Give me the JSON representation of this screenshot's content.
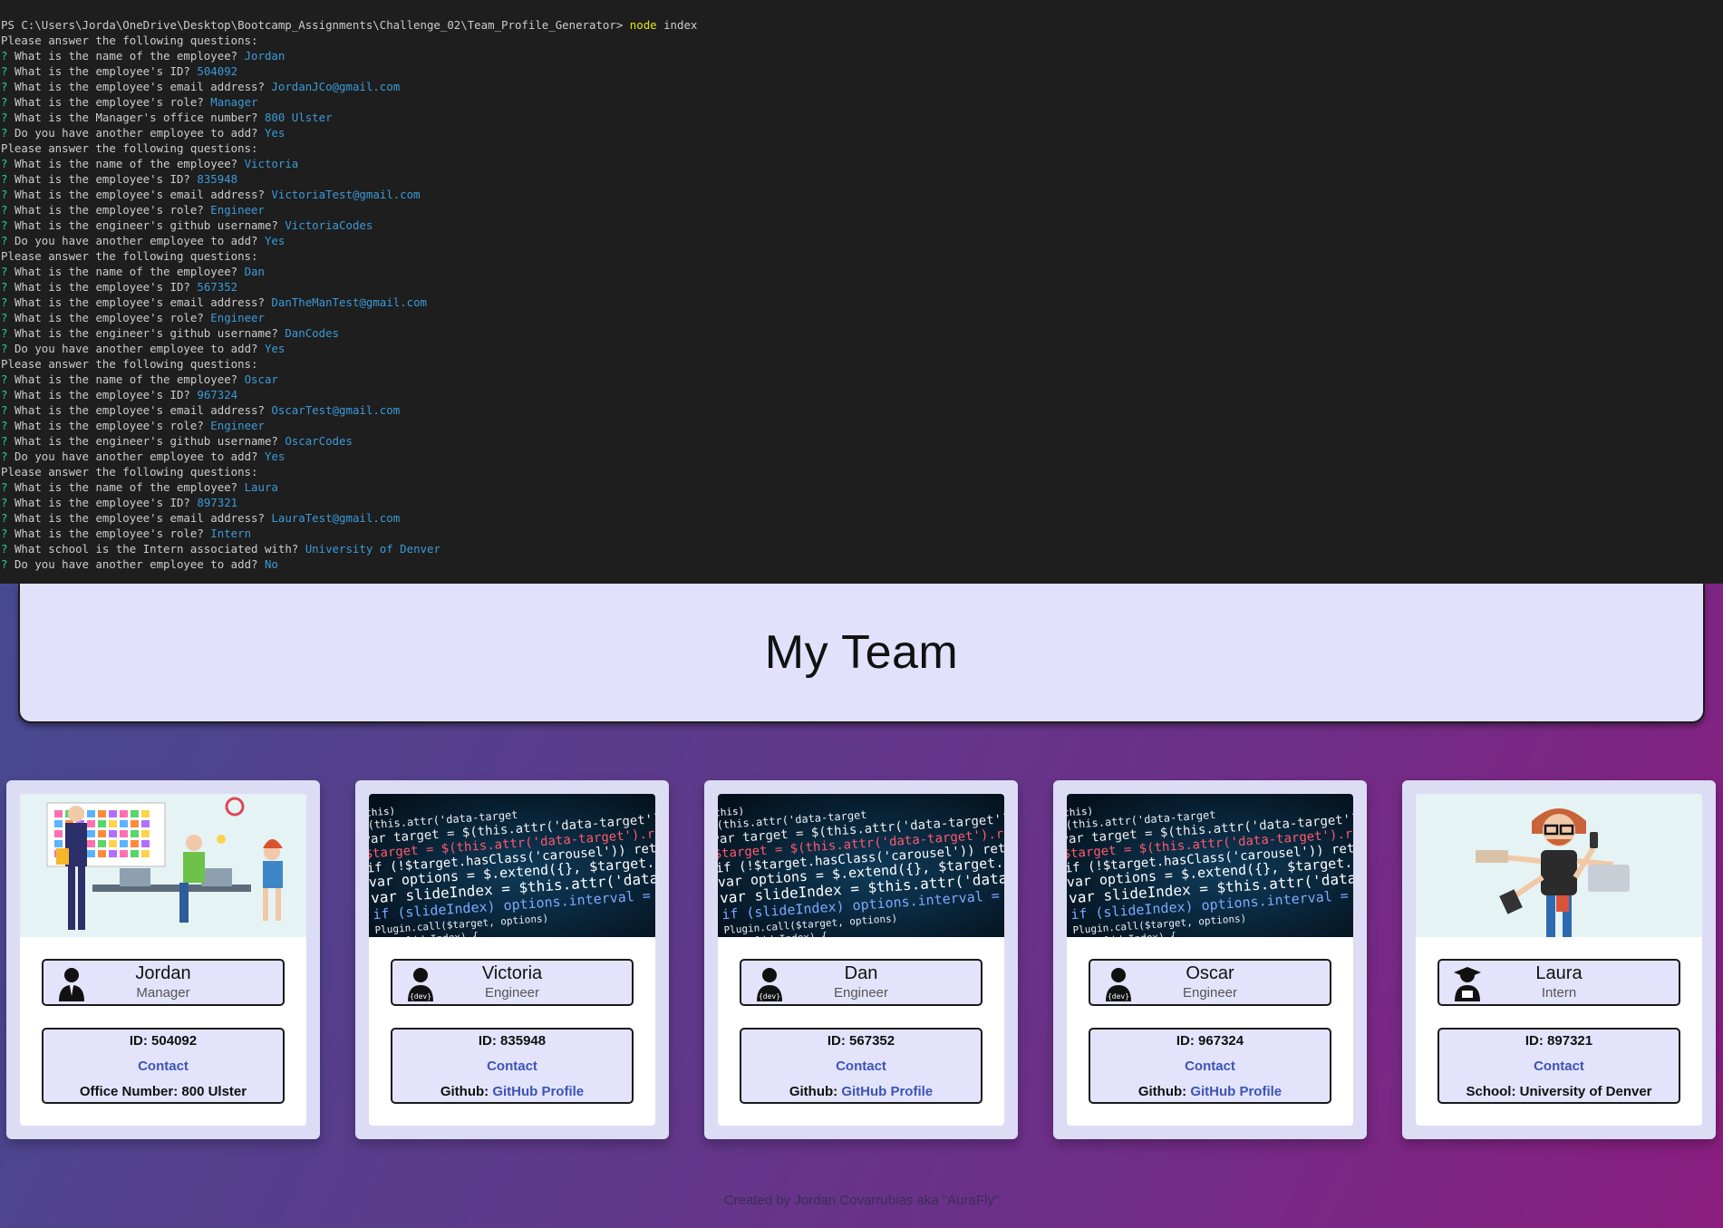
{
  "terminal": {
    "prompt_path": "PS C:\\Users\\Jorda\\OneDrive\\Desktop\\Bootcamp_Assignments\\Challenge_02\\Team_Profile_Generator>",
    "command": "node",
    "command_arg": "index",
    "lines": [
      {
        "type": "plain",
        "text": "Please answer the following questions:"
      },
      {
        "type": "qa",
        "mark": "?",
        "q": "What is the name of the employee?",
        "a": "Jordan"
      },
      {
        "type": "qa",
        "mark": "?",
        "q": "What is the employee's ID?",
        "a": "504092"
      },
      {
        "type": "qa",
        "mark": "?",
        "q": "What is the employee's email address?",
        "a": "JordanJCo@gmail.com"
      },
      {
        "type": "qa",
        "mark": "?",
        "q": "What is the employee's role?",
        "a": "Manager"
      },
      {
        "type": "qa",
        "mark": "?",
        "q": "What is the Manager's office number?",
        "a": "800 Ulster"
      },
      {
        "type": "qa",
        "mark": "?",
        "q": "Do you have another employee to add?",
        "a": "Yes"
      },
      {
        "type": "plain",
        "text": "Please answer the following questions:"
      },
      {
        "type": "qa",
        "mark": "?",
        "q": "What is the name of the employee?",
        "a": "Victoria"
      },
      {
        "type": "qa",
        "mark": "?",
        "q": "What is the employee's ID?",
        "a": "835948"
      },
      {
        "type": "qa",
        "mark": "?",
        "q": "What is the employee's email address?",
        "a": "VictoriaTest@gmail.com"
      },
      {
        "type": "qa",
        "mark": "?",
        "q": "What is the employee's role?",
        "a": "Engineer"
      },
      {
        "type": "qa",
        "mark": "?",
        "q": "What is the engineer's github username?",
        "a": "VictoriaCodes"
      },
      {
        "type": "qa",
        "mark": "?",
        "q": "Do you have another employee to add?",
        "a": "Yes"
      },
      {
        "type": "plain",
        "text": "Please answer the following questions:"
      },
      {
        "type": "qa",
        "mark": "?",
        "q": "What is the name of the employee?",
        "a": "Dan"
      },
      {
        "type": "qa",
        "mark": "?",
        "q": "What is the employee's ID?",
        "a": "567352"
      },
      {
        "type": "qa",
        "mark": "?",
        "q": "What is the employee's email address?",
        "a": "DanTheManTest@gmail.com"
      },
      {
        "type": "qa",
        "mark": "?",
        "q": "What is the employee's role?",
        "a": "Engineer"
      },
      {
        "type": "qa",
        "mark": "?",
        "q": "What is the engineer's github username?",
        "a": "DanCodes"
      },
      {
        "type": "qa",
        "mark": "?",
        "q": "Do you have another employee to add?",
        "a": "Yes"
      },
      {
        "type": "plain",
        "text": "Please answer the following questions:"
      },
      {
        "type": "qa",
        "mark": "?",
        "q": "What is the name of the employee?",
        "a": "Oscar"
      },
      {
        "type": "qa",
        "mark": "?",
        "q": "What is the employee's ID?",
        "a": "967324"
      },
      {
        "type": "qa",
        "mark": "?",
        "q": "What is the employee's email address?",
        "a": "OscarTest@gmail.com"
      },
      {
        "type": "qa",
        "mark": "?",
        "q": "What is the employee's role?",
        "a": "Engineer"
      },
      {
        "type": "qa",
        "mark": "?",
        "q": "What is the engineer's github username?",
        "a": "OscarCodes"
      },
      {
        "type": "qa",
        "mark": "?",
        "q": "Do you have another employee to add?",
        "a": "Yes"
      },
      {
        "type": "plain",
        "text": "Please answer the following questions:"
      },
      {
        "type": "qa",
        "mark": "?",
        "q": "What is the name of the employee?",
        "a": "Laura"
      },
      {
        "type": "qa",
        "mark": "?",
        "q": "What is the employee's ID?",
        "a": "897321"
      },
      {
        "type": "qa",
        "mark": "?",
        "q": "What is the employee's email address?",
        "a": "LauraTest@gmail.com"
      },
      {
        "type": "qa",
        "mark": "?",
        "q": "What is the employee's role?",
        "a": "Intern"
      },
      {
        "type": "qa",
        "mark": "?",
        "q": "What school is the Intern associated with?",
        "a": "University of Denver"
      },
      {
        "type": "qa",
        "mark": "?",
        "q": "Do you have another employee to add?",
        "a": "No"
      }
    ]
  },
  "header": {
    "title": "My Team"
  },
  "cards": [
    {
      "name": "Jordan",
      "role": "Manager",
      "role_icon": "manager-icon",
      "id_label": "ID: 504092",
      "contact": "Contact",
      "extra_label": "Office Number: 800 Ulster",
      "extra_link": "",
      "image": "office-team-illustration"
    },
    {
      "name": "Victoria",
      "role": "Engineer",
      "role_icon": "developer-icon",
      "id_label": "ID: 835948",
      "contact": "Contact",
      "extra_label": "Github: ",
      "extra_link": "GitHub Profile",
      "image": "code-screen-photo"
    },
    {
      "name": "Dan",
      "role": "Engineer",
      "role_icon": "developer-icon",
      "id_label": "ID: 567352",
      "contact": "Contact",
      "extra_label": "Github: ",
      "extra_link": "GitHub Profile",
      "image": "code-screen-photo"
    },
    {
      "name": "Oscar",
      "role": "Engineer",
      "role_icon": "developer-icon",
      "id_label": "ID: 967324",
      "contact": "Contact",
      "extra_label": "Github: ",
      "extra_link": "GitHub Profile",
      "image": "code-screen-photo"
    },
    {
      "name": "Laura",
      "role": "Intern",
      "role_icon": "graduate-icon",
      "id_label": "ID: 897321",
      "contact": "Contact",
      "extra_label": "School: University of Denver",
      "extra_link": "",
      "image": "multitasking-intern-illustration"
    }
  ],
  "code_snippet": [
    "(this)",
    "$(this.attr('data-target",
    "var target = $(this.attr('data-target'), '')) // st",
    "$target = $(this.attr('data-target').replace(/.*(?=#[^\\s]+$)/, '')) return",
    "if (!$target.hasClass('carousel')) return",
    "var options = $.extend({}, $target.data(), $",
    "var slideIndex = $this.attr('data-slide-to')",
    "if (slideIndex) options.interval = false",
    "Plugin.call($target, options)",
    "if (slideIndex) {"
  ],
  "footer": {
    "text": "Created by Jordan Covarrubias aka \"AuraFly\""
  },
  "colors": {
    "terminal_bg": "#1e1e1e",
    "prompt_green": "#23d18b",
    "answer_blue": "#3b9ad8",
    "command_yellow": "#e5e510",
    "header_bg": "#e1e1fb",
    "link": "#3c55b4"
  }
}
